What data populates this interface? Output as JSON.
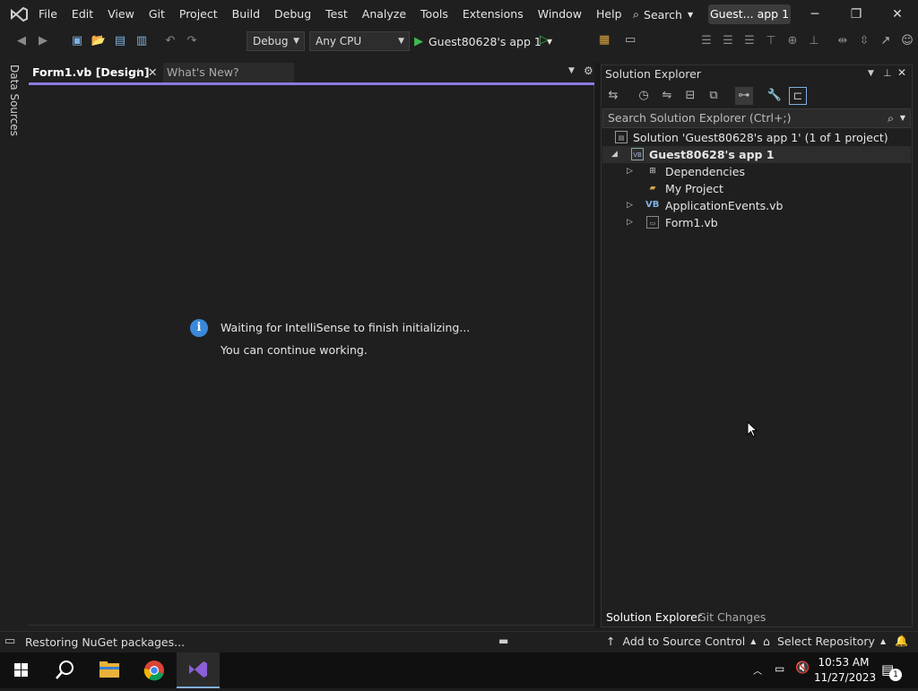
{
  "menubar": {
    "items": [
      "File",
      "Edit",
      "View",
      "Git",
      "Project",
      "Build",
      "Debug",
      "Test",
      "Analyze",
      "Tools",
      "Extensions",
      "Window",
      "Help"
    ],
    "search_label": "Search",
    "title": "Guest... app 1"
  },
  "toolbar": {
    "config": "Debug",
    "platform": "Any CPU",
    "run_target": "Guest80628's app 1"
  },
  "left_strip": {
    "data_sources": "Data Sources"
  },
  "doc_tabs": [
    {
      "label": "Form1.vb [Design]",
      "active": true
    },
    {
      "label": "What's New?",
      "active": false
    }
  ],
  "editor": {
    "message_line1": "Waiting for IntelliSense to finish initializing...",
    "message_line2": "You can continue working."
  },
  "solution_explorer": {
    "title": "Solution Explorer",
    "search_placeholder": "Search Solution Explorer (Ctrl+;)",
    "tree": [
      {
        "label": "Solution 'Guest80628's app 1' (1 of 1 project)",
        "level": 0,
        "icon": "solution-icon",
        "expander": ""
      },
      {
        "label": "Guest80628's app 1",
        "level": 1,
        "icon": "vb-project-icon",
        "expander": "◢",
        "bold": true
      },
      {
        "label": "Dependencies",
        "level": 2,
        "icon": "dependencies-icon",
        "expander": "▷"
      },
      {
        "label": "My Project",
        "level": 2,
        "icon": "wrench-folder-icon",
        "expander": ""
      },
      {
        "label": "ApplicationEvents.vb",
        "level": 2,
        "icon": "vb-file-icon",
        "expander": "▷"
      },
      {
        "label": "Form1.vb",
        "level": 2,
        "icon": "form-icon",
        "expander": "▷"
      }
    ],
    "bottom_tabs": [
      "Solution Explorer",
      "Git Changes"
    ]
  },
  "statusbar": {
    "message": "Restoring NuGet packages...",
    "source_control": "Add to Source Control",
    "repository": "Select Repository"
  },
  "taskbar": {
    "time": "10:53 AM",
    "date": "11/27/2023",
    "notification_count": "1"
  },
  "colors": {
    "accent": "#8b7be0",
    "info": "#3a88d8",
    "run_green": "#3fb950"
  }
}
